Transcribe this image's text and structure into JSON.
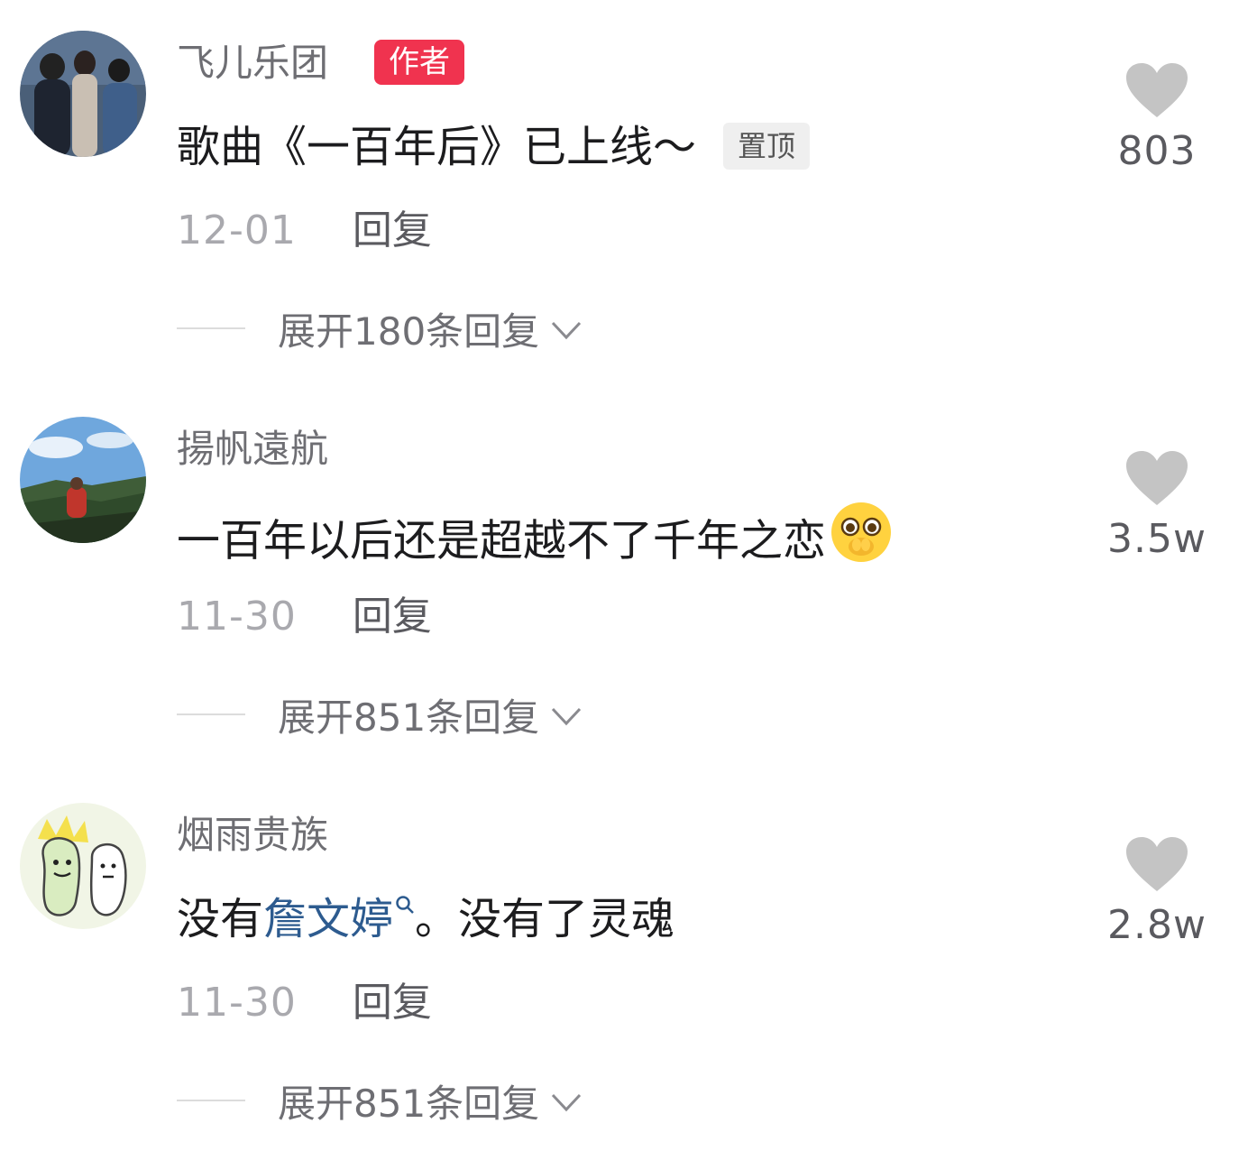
{
  "comments": [
    {
      "username": "飞儿乐团",
      "author_badge": "作者",
      "content": "歌曲《一百年后》已上线～",
      "pin_label": "置顶",
      "date": "12-01",
      "reply_label": "回复",
      "expand_label": "展开180条回复",
      "like_count": "803",
      "avatar": "band-photo-avatar"
    },
    {
      "username": "揚帆遠航",
      "content": "一百年以后还是超越不了千年之恋",
      "emoji": "pleading-face-emoji",
      "date": "11-30",
      "reply_label": "回复",
      "expand_label": "展开851条回复",
      "like_count": "3.5w",
      "avatar": "landscape-photo-avatar"
    },
    {
      "username": "烟雨贵族",
      "content_before": "没有",
      "mention": "詹文婷",
      "content_after": "。没有了灵魂",
      "date": "11-30",
      "reply_label": "回复",
      "expand_label": "展开851条回复",
      "like_count": "2.8w",
      "avatar": "cartoon-sketch-avatar"
    }
  ],
  "icons": {
    "like": "heart-icon",
    "expand": "chevron-down-icon",
    "mention_search": "search-icon"
  },
  "colors": {
    "author_badge": "#f0334f",
    "mention": "#2d5b8f",
    "heart": "#c4c4c4",
    "text_primary": "#1c1c1e",
    "text_secondary": "#6e6e73",
    "date": "#a9a9ae"
  }
}
